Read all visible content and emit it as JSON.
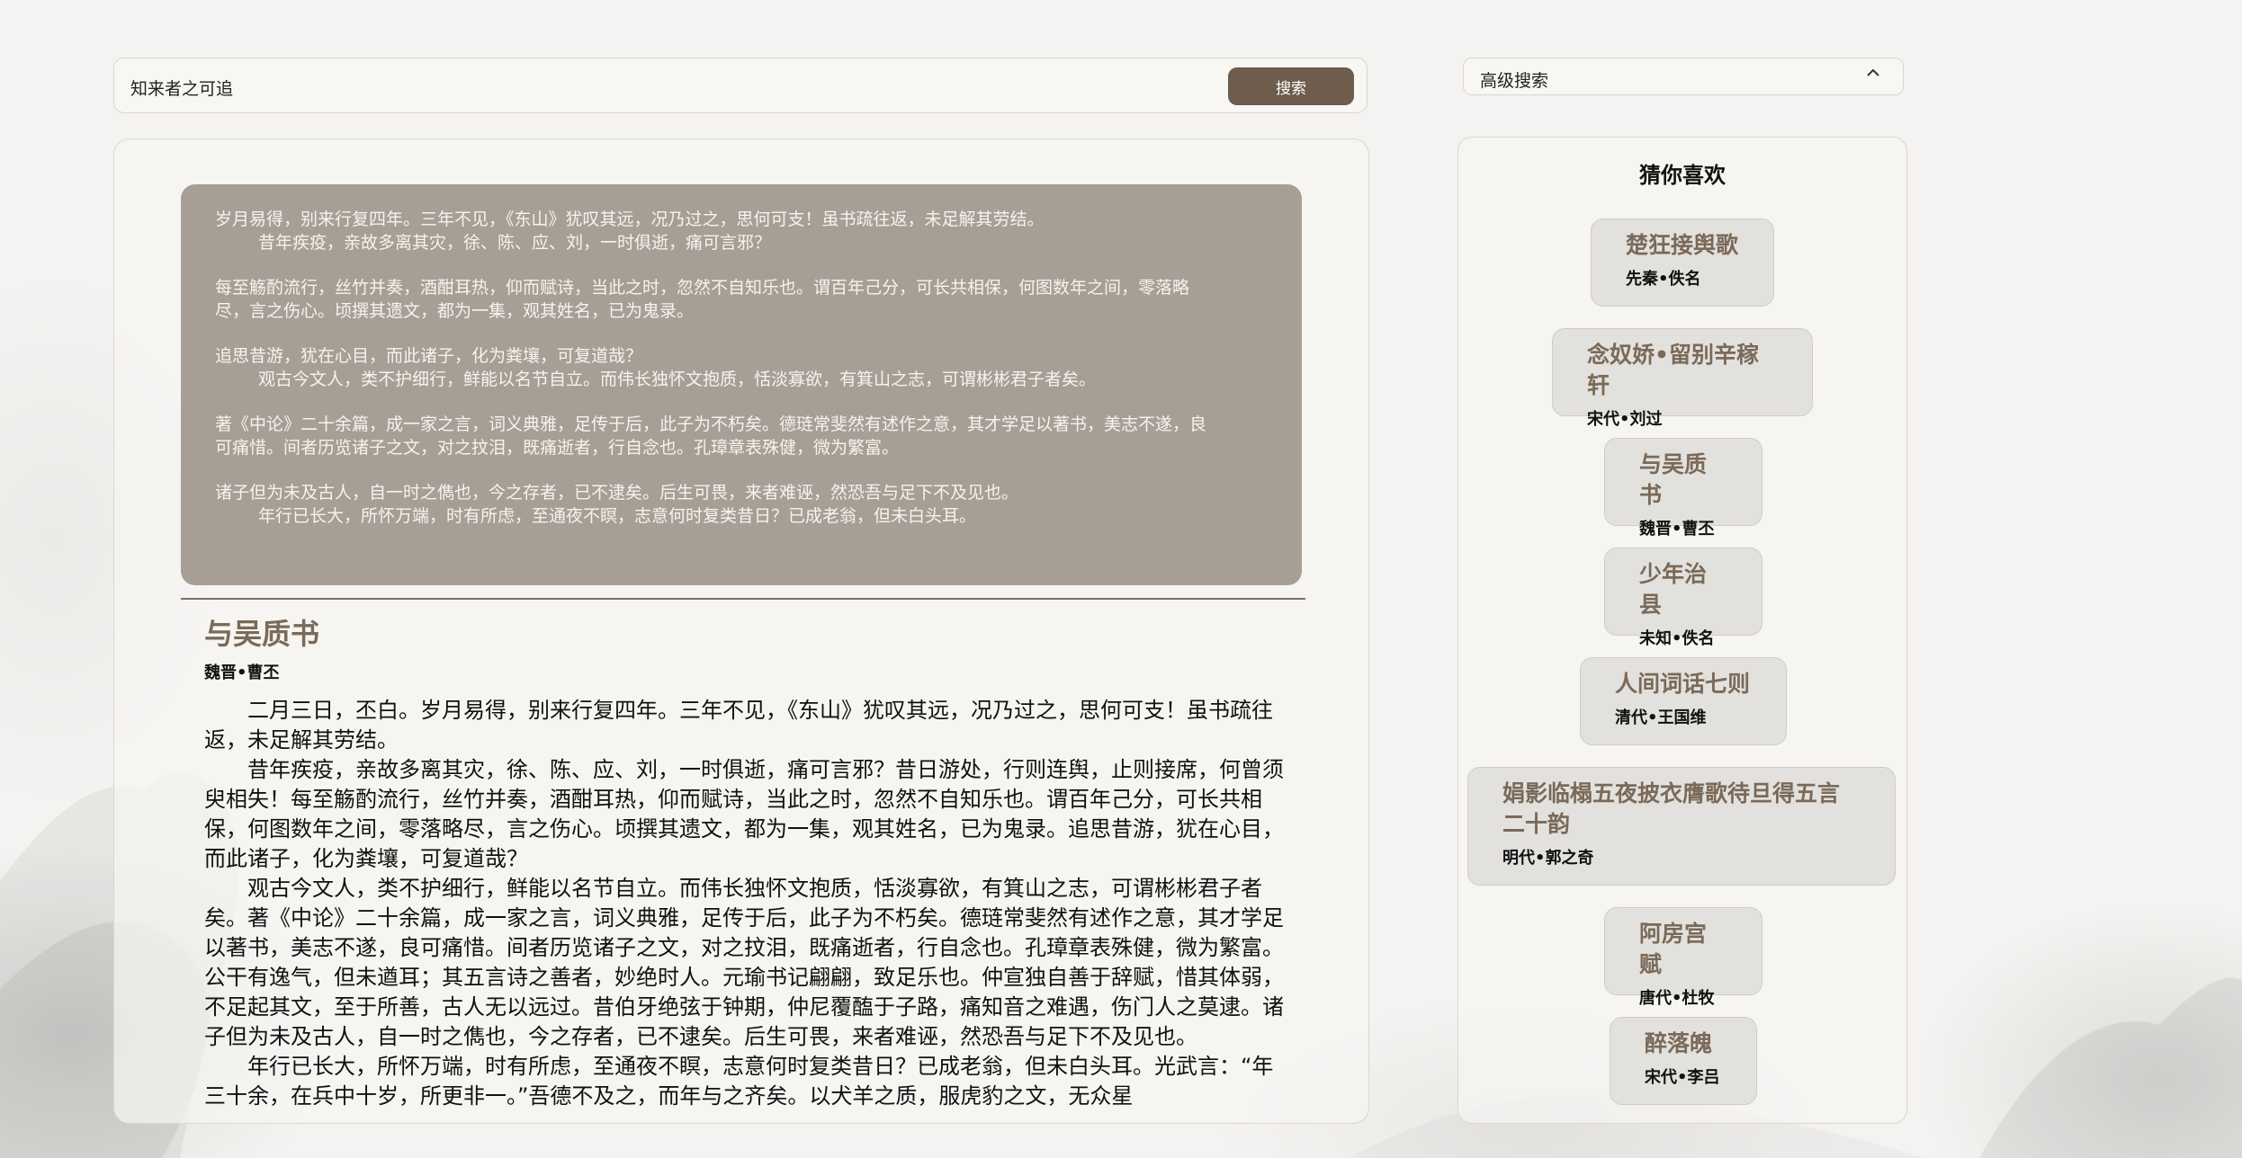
{
  "search": {
    "value": "知来者之可追",
    "button_label": "搜索"
  },
  "advanced_search": {
    "label": "高级搜索",
    "chevron": "chevron-up-icon"
  },
  "hits": [
    {
      "l1": "岁月易得，别来行复四年。三年不见，《东山》犹叹其远，况乃过之，思何可支！虽书疏往返，未足解其劳结。",
      "l2": "昔年疾疫，亲故多离其灾，徐、陈、应、刘，一时俱逝，痛可言邪？"
    },
    {
      "l1": "每至觞酌流行，丝竹并奏，酒酣耳热，仰而赋诗，当此之时，忽然不自知乐也。谓百年己分，可长共相保，何图数年之间，零落略",
      "l2": "尽，言之伤心。顷撰其遗文，都为一集，观其姓名，已为鬼录。"
    },
    {
      "l1": "追思昔游，犹在心目，而此诸子，化为粪壤，可复道哉？",
      "l2": "观古今文人，类不护细行，鲜能以名节自立。而伟长独怀文抱质，恬淡寡欲，有箕山之志，可谓彬彬君子者矣。"
    },
    {
      "l1": "著《中论》二十余篇，成一家之言，词义典雅，足传于后，此子为不朽矣。德琏常斐然有述作之意，其才学足以著书，美志不遂，良",
      "l2": "可痛惜。间者历览诸子之文，对之抆泪，既痛逝者，行自念也。孔璋章表殊健，微为繁富。"
    },
    {
      "l1": "诸子但为未及古人，自一时之儁也，今之存者，已不逮矣。后生可畏，来者难诬，然恐吾与足下不及见也。",
      "l2": "年行已长大，所怀万端，时有所虑，至通夜不瞑，志意何时复类昔日？已成老翁，但未白头耳。"
    }
  ],
  "article": {
    "title": "与吴质书",
    "author": "魏晋•曹丕",
    "paragraphs": [
      "二月三日，丕白。岁月易得，别来行复四年。三年不见，《东山》犹叹其远，况乃过之，思何可支！虽书疏往返，未足解其劳结。",
      "昔年疾疫，亲故多离其灾，徐、陈、应、刘，一时俱逝，痛可言邪？昔日游处，行则连舆，止则接席，何曾须臾相失！每至觞酌流行，丝竹并奏，酒酣耳热，仰而赋诗，当此之时，忽然不自知乐也。谓百年己分，可长共相保，何图数年之间，零落略尽，言之伤心。顷撰其遗文，都为一集，观其姓名，已为鬼录。追思昔游，犹在心目，而此诸子，化为粪壤，可复道哉？",
      "观古今文人，类不护细行，鲜能以名节自立。而伟长独怀文抱质，恬淡寡欲，有箕山之志，可谓彬彬君子者矣。著《中论》二十余篇，成一家之言，词义典雅，足传于后，此子为不朽矣。德琏常斐然有述作之意，其才学足以著书，美志不遂，良可痛惜。间者历览诸子之文，对之抆泪，既痛逝者，行自念也。孔璋章表殊健，微为繁富。公干有逸气，但未遒耳；其五言诗之善者，妙绝时人。元瑜书记翩翩，致足乐也。仲宣独自善于辞赋，惜其体弱，不足起其文，至于所善，古人无以远过。昔伯牙绝弦于钟期，仲尼覆醢于子路，痛知音之难遇，伤门人之莫逮。诸子但为未及古人，自一时之儁也，今之存者，已不逮矣。后生可畏，来者难诬，然恐吾与足下不及见也。",
      "年行已长大，所怀万端，时有所虑，至通夜不瞑，志意何时复类昔日？已成老翁，但未白头耳。光武言：“年三十余，在兵中十岁，所更非一。”吾德不及之，而年与之齐矣。以犬羊之质，服虎豹之文，无众星"
    ]
  },
  "sidebar": {
    "title": "猜你喜欢",
    "items": [
      {
        "title": "楚狂接舆歌",
        "author": "先秦•佚名"
      },
      {
        "title": "念奴娇•留别辛稼轩",
        "author": "宋代•刘过"
      },
      {
        "title": "与吴质书",
        "author": "魏晋•曹丕"
      },
      {
        "title": "少年治县",
        "author": "未知•佚名"
      },
      {
        "title": "人间词话七则",
        "author": "清代•王国维"
      },
      {
        "title": "娟影临榻五夜披衣膺歌待旦得五言二十韵",
        "author": "明代•郭之奇"
      },
      {
        "title": "阿房宫赋",
        "author": "唐代•杜牧"
      },
      {
        "title": "醉落魄",
        "author": "宋代•李吕"
      }
    ]
  }
}
